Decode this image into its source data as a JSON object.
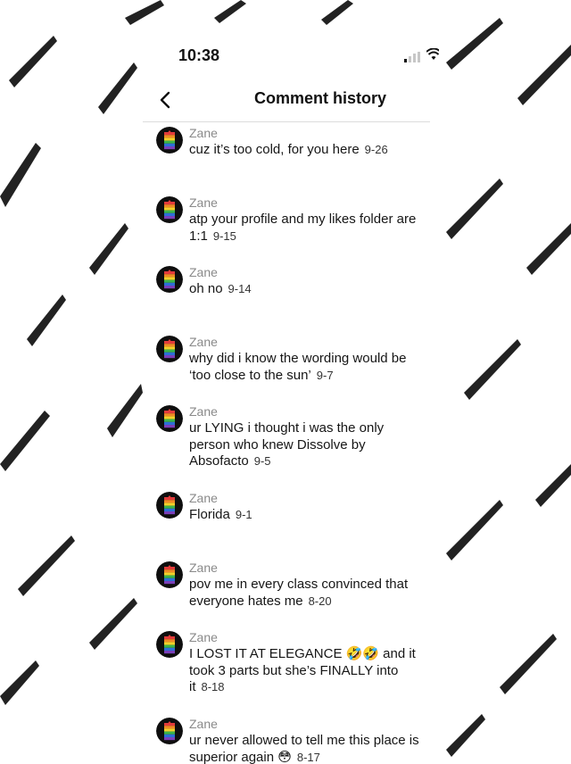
{
  "status_bar": {
    "time": "10:38"
  },
  "header": {
    "title": "Comment history",
    "back_icon": "chevron-left-icon"
  },
  "comments": [
    {
      "user": "Zane",
      "text": "cuz it’s too cold, for you here",
      "date": "9-26"
    },
    {
      "user": "Zane",
      "text": "atp your profile and my likes folder are 1:1",
      "date": "9-15"
    },
    {
      "user": "Zane",
      "text": "oh no",
      "date": "9-14"
    },
    {
      "user": "Zane",
      "text": "why did i know the wording would be ‘too close to the sun’",
      "date": "9-7"
    },
    {
      "user": "Zane",
      "text": "ur LYING i thought i was the only person who knew Dissolve by Absofacto",
      "date": "9-5"
    },
    {
      "user": "Zane",
      "text": "Florida",
      "date": "9-1"
    },
    {
      "user": "Zane",
      "text": "pov me in every class convinced that everyone hates me",
      "date": "8-20"
    },
    {
      "user": "Zane",
      "text": "I LOST IT AT ELEGANCE 🤣🤣 and it took 3 parts but she’s FINALLY into it",
      "date": "8-18"
    },
    {
      "user": "Zane",
      "text": "ur never allowed to tell me this place is superior again 😳",
      "date": "8-17"
    }
  ],
  "colors": {
    "background": "#ffffff",
    "text": "#161616",
    "username": "#8a8a8a",
    "divider": "#dcdcdc"
  }
}
